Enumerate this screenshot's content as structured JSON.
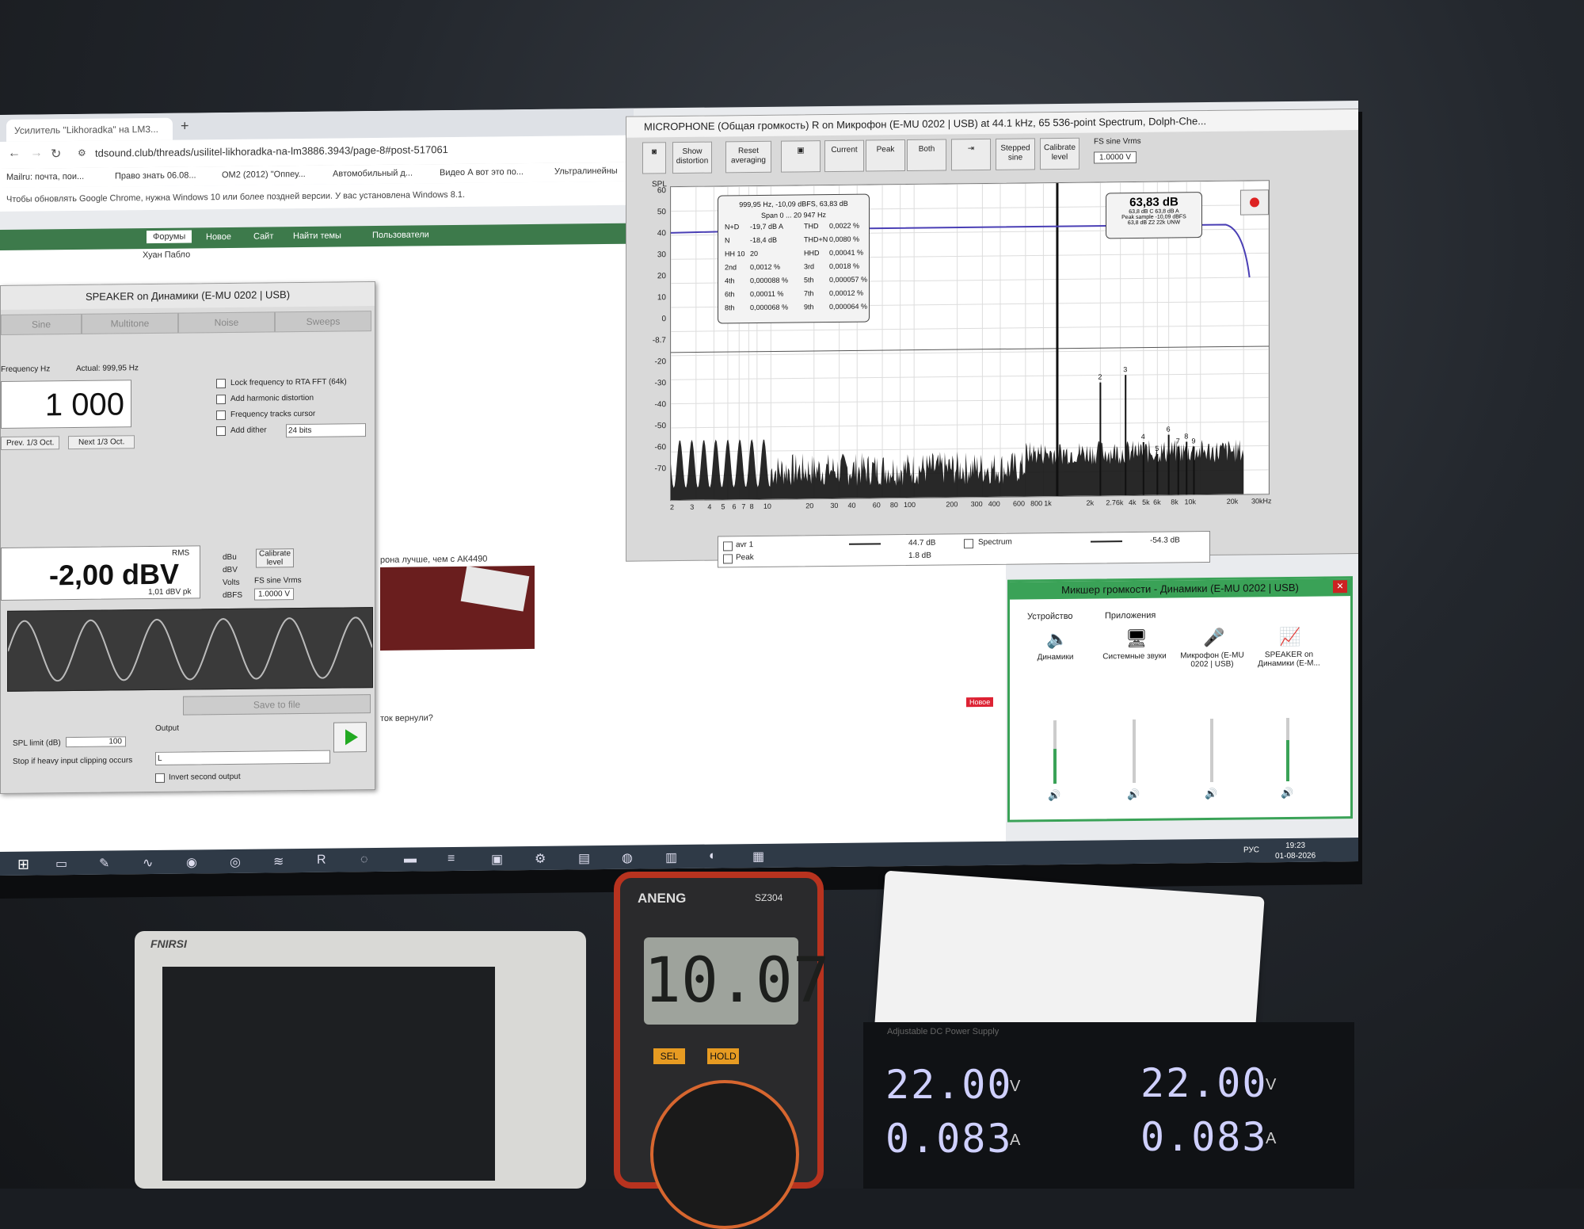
{
  "browser": {
    "tab_title": "Усилитель \"Likhoradka\" на LM3...",
    "url": "tdsound.club/threads/usilitel-likhoradka-na-lm3886.3943/page-8#post-517061",
    "bookmarks": [
      "Мailru: почта, пои...",
      "Право знать 06.08...",
      "OM2 (2012) \"Оппеу...",
      "Автомобильный д...",
      "Видео А вот это по...",
      "Ультралинейны"
    ],
    "update_notice": "Чтобы обновлять Google Chrome, нужна Windows 10 или более поздней версии. У вас установлена Windows 8.1.",
    "forum_nav": [
      "Форумы",
      "Новое",
      "Сайт",
      "Найти темы",
      "Пользователи"
    ],
    "author": "Хуан Пабло",
    "post_text_1": "рона лучше, чем с АК4490",
    "post_text_2": "ток вернули?",
    "new_badge": "Новое"
  },
  "generator": {
    "title": "SPEAKER on Динамики (E-MU 0202 | USB)",
    "tabs": [
      "Sine",
      "Multitone",
      "Noise",
      "Sweeps"
    ],
    "frequency_label": "Frequency Hz",
    "actual_label": "Actual: 999,95 Hz",
    "frequency": "1 000",
    "prev_btn": "Prev. 1/3 Oct.",
    "next_btn": "Next 1/3 Oct.",
    "options": [
      "Lock frequency to RTA FFT (64k)",
      "Add harmonic distortion",
      "Frequency tracks cursor",
      "Add dither"
    ],
    "dither_bits": "24 bits",
    "level": "-2,00 dBV",
    "rms_label": "RMS",
    "level_pk": "1,01 dBV pk",
    "units": [
      "dBu",
      "dBV",
      "Volts",
      "dBFS"
    ],
    "calibrate_btn": "Calibrate level",
    "fs_sine_label": "FS sine Vrms",
    "fs_sine_val": "1.0000 V",
    "save_btn": "Save to file",
    "output_label": "Output",
    "spl_limit_label": "SPL limit (dB)",
    "spl_limit_val": "100",
    "stop_label": "Stop if heavy input clipping occurs",
    "invert_label": "Invert second output",
    "output_channel": "L"
  },
  "rta": {
    "title": "MICROPHONE (Общая громкость) R on Микрофон (E-MU 0202 | USB) at 44.1 kHz, 65 536-point Spectrum, Dolph-Che...",
    "toolbar": [
      "Show distortion",
      "Reset averaging",
      "",
      "Current",
      "Peak",
      "Both",
      "",
      "Stepped sine",
      "Calibrate level"
    ],
    "fs_label": "FS sine Vrms",
    "fs_val": "1.0000 V",
    "spl_label": "SPL",
    "yticks": [
      "60",
      "50",
      "40",
      "30",
      "20",
      "10",
      "0",
      "-8.7",
      "-20",
      "-30",
      "-40",
      "-50",
      "-60",
      "-70"
    ],
    "xticks": [
      "2",
      "3",
      "4",
      "5",
      "6",
      "7",
      "8",
      "10",
      "20",
      "30",
      "40",
      "60",
      "80",
      "100",
      "200",
      "300",
      "400",
      "600",
      "800",
      "1k",
      "2k",
      "2.76k",
      "4k",
      "5k",
      "6k",
      "8k",
      "10k",
      "20k",
      "30kHz"
    ],
    "info_header": "999,95 Hz, -10,09 dBFS, 63,83 dB",
    "info_span": "Span  0 ... 20 947 Hz",
    "info_rows": [
      [
        "N+D",
        "-19,7 dB A",
        "THD",
        "0,0022 %"
      ],
      [
        "N",
        "-18,4 dB",
        "THD+N",
        "0,0080 %"
      ],
      [
        "HH 10",
        "20",
        "HHD",
        "0,00041 %"
      ],
      [
        "2nd",
        "0,0012 %",
        "3rd",
        "0,0018 %"
      ],
      [
        "4th",
        "0,000088 %",
        "5th",
        "0,000057 %"
      ],
      [
        "6th",
        "0,00011 %",
        "7th",
        "0,00012 %"
      ],
      [
        "8th",
        "0,000068 %",
        "9th",
        "0,000064 %"
      ]
    ],
    "peak_value": "63,83 dB",
    "peak_line1": "63,8 dB C   63,8 dB A",
    "peak_line2": "Peak sample  -10,09 dBFS",
    "peak_line3": "63,8 dB Z2   22k UNW",
    "harmonic_labels": [
      "2",
      "3",
      "4",
      "5",
      "6",
      "7",
      "8",
      "9"
    ],
    "legend": [
      {
        "name": "avr 1",
        "value": "44.7 dB"
      },
      {
        "name": "Spectrum",
        "value": "-54.3 dB"
      },
      {
        "name": "Peak",
        "value": "1.8 dB"
      }
    ]
  },
  "mixer": {
    "title": "Микшер громкости - Динамики (E-MU 0202 | USB)",
    "device_label": "Устройство",
    "apps_label": "Приложения",
    "channels": [
      {
        "name": "Динамики",
        "level": 0.55
      },
      {
        "name": "Системные звуки",
        "level": 0.0
      },
      {
        "name": "Микрофон (E-MU 0202 | USB)",
        "level": 0.0
      },
      {
        "name": "SPEAKER on Динамики (E-M...",
        "level": 0.65
      }
    ]
  },
  "taskbar": {
    "lang": "РУС",
    "time": "19:23",
    "date": "01-08-2026"
  },
  "bench": {
    "scope_brand": "FNIRSI",
    "meter_brand": "ANENG",
    "meter_model": "SZ304",
    "meter_reading": "10.07",
    "meter_sel": "SEL",
    "meter_hold": "HOLD",
    "psu_label": "Adjustable DC Power Supply",
    "psu_v1": "22.00",
    "psu_a1": "0.083",
    "psu_v2": "22.00",
    "psu_a2": "0.083",
    "unit_v": "V",
    "unit_a": "A"
  },
  "colors": {
    "spectrum_fill": "#111111",
    "avg_curve": "#4a3fb5",
    "forum_green": "#3d7a4b",
    "mixer_green": "#3aa257",
    "psu_digit": "#cfd0ff",
    "meter_red": "#b8331f"
  }
}
